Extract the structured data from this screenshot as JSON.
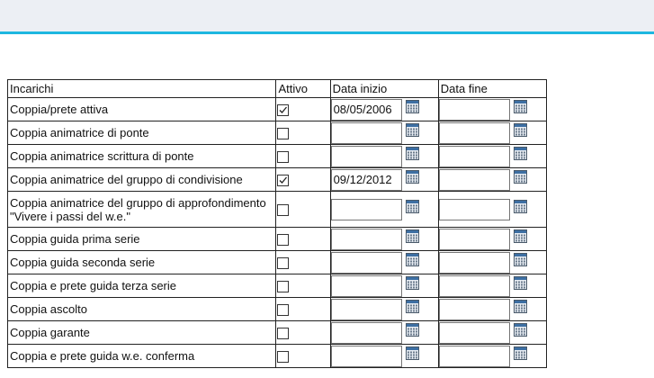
{
  "headers": {
    "incarichi": "Incarichi",
    "attivo": "Attivo",
    "data_inizio": "Data inizio",
    "data_fine": "Data fine"
  },
  "rows": [
    {
      "label": "Coppia/prete attiva",
      "attivo": true,
      "data_inizio": "08/05/2006",
      "data_fine": ""
    },
    {
      "label": "Coppia animatrice di ponte",
      "attivo": false,
      "data_inizio": "",
      "data_fine": ""
    },
    {
      "label": "Coppia animatrice scrittura di ponte",
      "attivo": false,
      "data_inizio": "",
      "data_fine": ""
    },
    {
      "label": "Coppia animatrice del gruppo di condivisione",
      "attivo": true,
      "data_inizio": "09/12/2012",
      "data_fine": ""
    },
    {
      "label": "Coppia animatrice del gruppo di approfondimento \"Vivere i passi del w.e.\"",
      "attivo": false,
      "data_inizio": "",
      "data_fine": ""
    },
    {
      "label": "Coppia guida prima serie",
      "attivo": false,
      "data_inizio": "",
      "data_fine": ""
    },
    {
      "label": "Coppia guida seconda serie",
      "attivo": false,
      "data_inizio": "",
      "data_fine": ""
    },
    {
      "label": "Coppia e prete guida terza serie",
      "attivo": false,
      "data_inizio": "",
      "data_fine": ""
    },
    {
      "label": "Coppia ascolto",
      "attivo": false,
      "data_inizio": "",
      "data_fine": ""
    },
    {
      "label": "Coppia garante",
      "attivo": false,
      "data_inizio": "",
      "data_fine": ""
    },
    {
      "label": "Coppia e prete guida w.e. conferma",
      "attivo": false,
      "data_inizio": "",
      "data_fine": ""
    }
  ],
  "icons": {
    "calendar": "calendar-icon",
    "checkbox_checked": "checkmark-icon"
  },
  "colors": {
    "topbar": "#eceff4",
    "accent": "#1eb7e0"
  }
}
